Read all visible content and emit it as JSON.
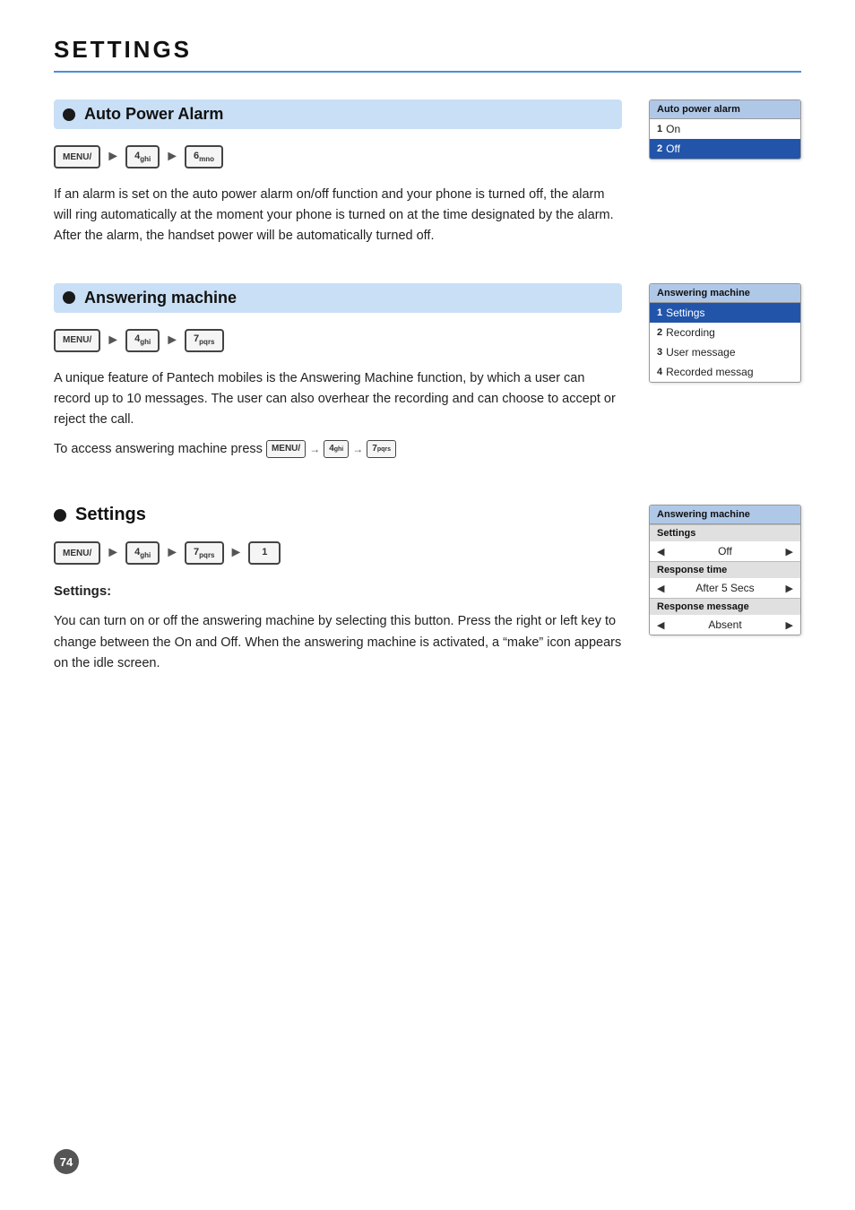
{
  "page": {
    "title": "SETTINGS",
    "page_number": "74"
  },
  "sections": {
    "auto_power_alarm": {
      "title": "Auto Power Alarm",
      "nav": [
        {
          "label": "MENU",
          "sub": ""
        },
        {
          "label": "4",
          "sub": "ghi"
        },
        {
          "label": "6",
          "sub": "mno"
        }
      ],
      "description": "If an alarm is set on the auto power alarm on/off function and your phone is turned off, the alarm will ring automatically at the moment your phone is turned on at the time designated by the alarm. After the alarm, the handset power will be automatically turned off.",
      "panel": {
        "title": "Auto power alarm",
        "items": [
          {
            "num": "1",
            "label": "On",
            "selected": false
          },
          {
            "num": "2",
            "label": "Off",
            "selected": true
          }
        ]
      }
    },
    "answering_machine": {
      "title": "Answering machine",
      "nav": [
        {
          "label": "MENU",
          "sub": ""
        },
        {
          "label": "4",
          "sub": "ghi"
        },
        {
          "label": "7",
          "sub": "pqrs"
        }
      ],
      "description": "A unique feature of Pantech mobiles is the Answering Machine function, by which a user can record up to 10 messages. The user can also overhear the recording and can choose to accept or reject the call.",
      "access_text": "To access answering machine press",
      "access_nav": [
        {
          "label": "MENU",
          "sub": ""
        },
        {
          "label": "4",
          "sub": "ghi"
        },
        {
          "label": "7",
          "sub": "pqrs"
        }
      ],
      "panel": {
        "title": "Answering machine",
        "items": [
          {
            "num": "1",
            "label": "Settings",
            "selected": true
          },
          {
            "num": "2",
            "label": "Recording",
            "selected": false
          },
          {
            "num": "3",
            "label": "User message",
            "selected": false
          },
          {
            "num": "4",
            "label": "Recorded messag",
            "selected": false
          }
        ]
      }
    },
    "settings_sub": {
      "title": "Settings",
      "nav": [
        {
          "label": "MENU",
          "sub": ""
        },
        {
          "label": "4",
          "sub": "ghi"
        },
        {
          "label": "7",
          "sub": "pqrs"
        },
        {
          "label": "1",
          "sub": ""
        }
      ],
      "subheader": "Settings:",
      "description": "You can turn on or off the answering machine by selecting this button. Press the right or left key to change between the On and Off. When the answering machine is activated, a “make” icon appears on the idle screen.",
      "panel": {
        "title": "Answering machine",
        "rows": [
          {
            "type": "subheader",
            "label": "Settings"
          },
          {
            "type": "value",
            "label": "Off",
            "has_arrows": true
          },
          {
            "type": "subheader",
            "label": "Response time"
          },
          {
            "type": "value",
            "label": "After 5 Secs",
            "has_arrows": true
          },
          {
            "type": "subheader",
            "label": "Response message"
          },
          {
            "type": "value",
            "label": "Absent",
            "has_arrows": true
          }
        ]
      }
    }
  },
  "icons": {
    "menu_label": "MENU",
    "arrow": "→"
  }
}
